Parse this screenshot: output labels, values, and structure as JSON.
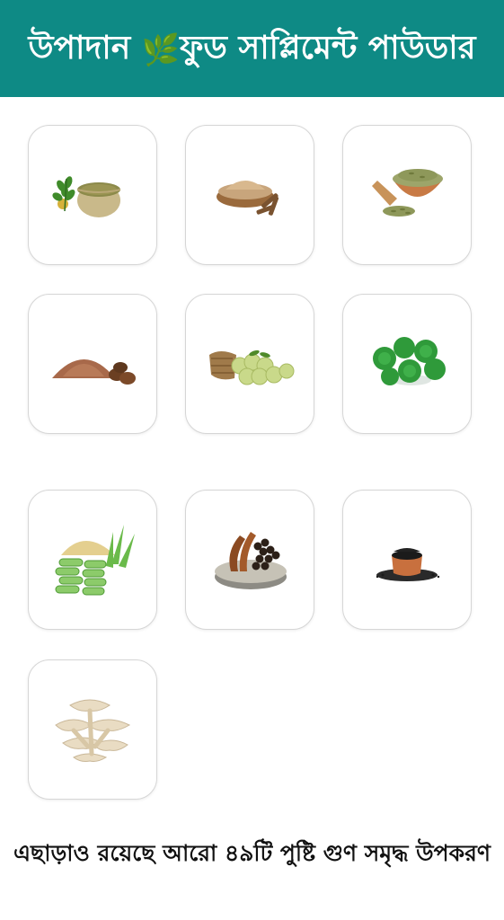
{
  "header": {
    "title_part1": "উপাদান",
    "leaf_icon": "🌿",
    "title_part2": "ফুড সাপ্লিমেন্ট পাউডার",
    "background_color": "#0e8a85"
  },
  "ingredients": [
    {
      "icon": "moringa-powder-icon"
    },
    {
      "icon": "ashwagandha-powder-icon"
    },
    {
      "icon": "fennel-seeds-icon"
    },
    {
      "icon": "nutmeg-powder-icon"
    },
    {
      "icon": "amla-basket-icon"
    },
    {
      "icon": "gotu-kola-leaves-icon"
    },
    {
      "icon": "aloe-vera-powder-icon"
    },
    {
      "icon": "cinnamon-pepper-icon"
    },
    {
      "icon": "black-seed-bowl-icon"
    },
    {
      "icon": "oyster-mushroom-icon"
    }
  ],
  "footer": {
    "text": "এছাড়াও রয়েছে আরো ৪৯টি পুষ্টি গুণ সমৃদ্ধ উপকরণ"
  }
}
